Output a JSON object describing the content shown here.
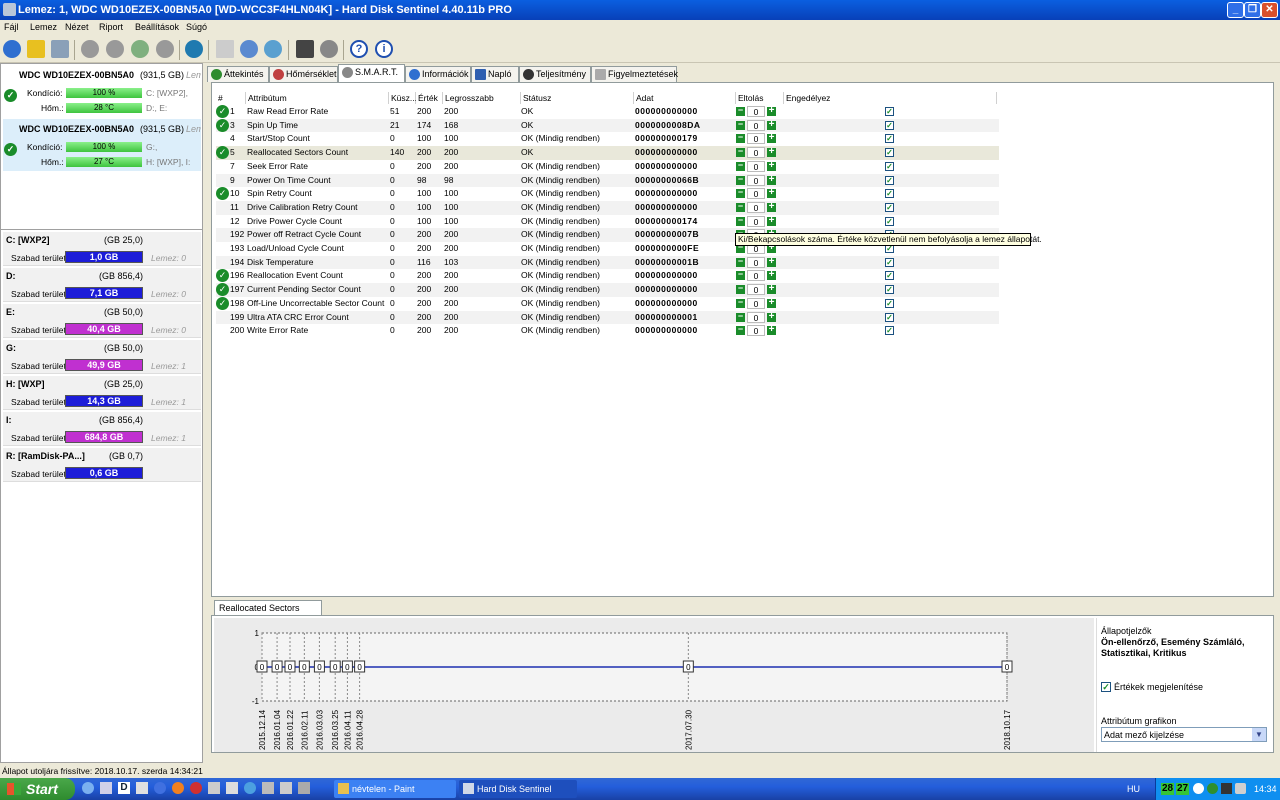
{
  "window": {
    "title": "Lemez: 1, WDC WD10EZEX-00BN5A0 [WD-WCC3F4HLN04K]  -  Hard Disk Sentinel 4.40.11b PRO"
  },
  "menu": [
    {
      "label": "Fájl"
    },
    {
      "label": "Lemez"
    },
    {
      "label": "Nézet"
    },
    {
      "label": "Riport"
    },
    {
      "label": "Beállítások"
    },
    {
      "label": "Súgó"
    }
  ],
  "disks": [
    {
      "name": "WDC WD10EZEX-00BN5A0",
      "size": "(931,5 GB)",
      "lem": "Lem",
      "cond_label": "Kondíció:",
      "cond_value": "100 %",
      "cond_parts": "C: [WXP2],",
      "temp_label": "Hőm.:",
      "temp_value": "28 °C",
      "temp_parts": "D:, E:"
    },
    {
      "name": "WDC WD10EZEX-00BN5A0",
      "size": "(931,5 GB)",
      "lem": "Lem",
      "cond_label": "Kondíció:",
      "cond_value": "100 %",
      "cond_parts": "G:,",
      "temp_label": "Hőm.:",
      "temp_value": "27 °C",
      "temp_parts": "H: [WXP], I:"
    }
  ],
  "partitions": [
    {
      "name": "C: [WXP2]",
      "size": "(25,0 GB)",
      "free_label": "Szabad terület",
      "free": "1,0 GB",
      "lemez": "Lemez: 0",
      "color": "#1c1cd8",
      "pct": 0.96
    },
    {
      "name": "D:",
      "size": "(856,4 GB)",
      "free_label": "Szabad terület",
      "free": "7,1 GB",
      "lemez": "Lemez: 0",
      "color": "#1c1cd8",
      "pct": 0.99
    },
    {
      "name": "E:",
      "size": "(50,0 GB)",
      "free_label": "Szabad terület",
      "free": "40,4 GB",
      "lemez": "Lemez: 0",
      "color": "#c030d0",
      "pct": 0.19
    },
    {
      "name": "G:",
      "size": "(50,0 GB)",
      "free_label": "Szabad terület",
      "free": "49,9 GB",
      "lemez": "Lemez: 1",
      "color": "#c030d0",
      "pct": 0.0
    },
    {
      "name": "H: [WXP]",
      "size": "(25,0 GB)",
      "free_label": "Szabad terület",
      "free": "14,3 GB",
      "lemez": "Lemez: 1",
      "color": "#1c1cd8",
      "pct": 0.43
    },
    {
      "name": "I:",
      "size": "(856,4 GB)",
      "free_label": "Szabad terület",
      "free": "684,8 GB",
      "lemez": "Lemez: 1",
      "color": "#c030d0",
      "pct": 0.2
    },
    {
      "name": "R: [RamDisk-PA...]",
      "size": "(0,7 GB)",
      "free_label": "Szabad terület",
      "free": "0,6 GB",
      "lemez": "",
      "color": "#1c1cd8",
      "pct": 0.14
    }
  ],
  "tabs": [
    {
      "label": "Áttekintés"
    },
    {
      "label": "Hőmérséklet"
    },
    {
      "label": "S.M.A.R.T."
    },
    {
      "label": "Információk"
    },
    {
      "label": "Napló"
    },
    {
      "label": "Teljesítmény"
    },
    {
      "label": "Figyelmeztetések"
    }
  ],
  "smart": {
    "headers": [
      "#",
      "Attribútum",
      "Küsz...",
      "Érték",
      "Legrosszabb",
      "Státusz",
      "Adat",
      "Eltolás",
      "Engedélyez"
    ],
    "rows": [
      {
        "id": "1",
        "name": "Raw Read Error Rate",
        "thr": "51",
        "val": "200",
        "worst": "200",
        "status": "OK",
        "data": "000000000000",
        "off": "0",
        "ok": true
      },
      {
        "id": "3",
        "name": "Spin Up Time",
        "thr": "21",
        "val": "174",
        "worst": "168",
        "status": "OK",
        "data": "0000000008DA",
        "off": "0",
        "ok": true
      },
      {
        "id": "4",
        "name": "Start/Stop Count",
        "thr": "0",
        "val": "100",
        "worst": "100",
        "status": "OK (Mindig rendben)",
        "data": "000000000179",
        "off": "0",
        "ok": false
      },
      {
        "id": "5",
        "name": "Reallocated Sectors Count",
        "thr": "140",
        "val": "200",
        "worst": "200",
        "status": "OK",
        "data": "000000000000",
        "off": "0",
        "ok": true
      },
      {
        "id": "7",
        "name": "Seek Error Rate",
        "thr": "0",
        "val": "200",
        "worst": "200",
        "status": "OK (Mindig rendben)",
        "data": "000000000000",
        "off": "0",
        "ok": false
      },
      {
        "id": "9",
        "name": "Power On Time Count",
        "thr": "0",
        "val": "98",
        "worst": "98",
        "status": "OK (Mindig rendben)",
        "data": "00000000066B",
        "off": "0",
        "ok": false
      },
      {
        "id": "10",
        "name": "Spin Retry Count",
        "thr": "0",
        "val": "100",
        "worst": "100",
        "status": "OK (Mindig rendben)",
        "data": "000000000000",
        "off": "0",
        "ok": true
      },
      {
        "id": "11",
        "name": "Drive Calibration Retry Count",
        "thr": "0",
        "val": "100",
        "worst": "100",
        "status": "OK (Mindig rendben)",
        "data": "000000000000",
        "off": "0",
        "ok": false
      },
      {
        "id": "12",
        "name": "Drive Power Cycle Count",
        "thr": "0",
        "val": "100",
        "worst": "100",
        "status": "OK (Mindig rendben)",
        "data": "000000000174",
        "off": "0",
        "ok": false
      },
      {
        "id": "192",
        "name": "Power off Retract Cycle Count",
        "thr": "0",
        "val": "200",
        "worst": "200",
        "status": "OK (Mindig rendben)",
        "data": "00000000007B",
        "off": "0",
        "ok": false
      },
      {
        "id": "193",
        "name": "Load/Unload Cycle Count",
        "thr": "0",
        "val": "200",
        "worst": "200",
        "status": "OK (Mindig rendben)",
        "data": "0000000000FE",
        "off": "0",
        "ok": false
      },
      {
        "id": "194",
        "name": "Disk Temperature",
        "thr": "0",
        "val": "116",
        "worst": "103",
        "status": "OK (Mindig rendben)",
        "data": "00000000001B",
        "off": "0",
        "ok": false
      },
      {
        "id": "196",
        "name": "Reallocation Event Count",
        "thr": "0",
        "val": "200",
        "worst": "200",
        "status": "OK (Mindig rendben)",
        "data": "000000000000",
        "off": "0",
        "ok": true
      },
      {
        "id": "197",
        "name": "Current Pending Sector Count",
        "thr": "0",
        "val": "200",
        "worst": "200",
        "status": "OK (Mindig rendben)",
        "data": "000000000000",
        "off": "0",
        "ok": true
      },
      {
        "id": "198",
        "name": "Off-Line Uncorrectable Sector Count",
        "thr": "0",
        "val": "200",
        "worst": "200",
        "status": "OK (Mindig rendben)",
        "data": "000000000000",
        "off": "0",
        "ok": true
      },
      {
        "id": "199",
        "name": "Ultra ATA CRC Error Count",
        "thr": "0",
        "val": "200",
        "worst": "200",
        "status": "OK (Mindig rendben)",
        "data": "000000000001",
        "off": "0",
        "ok": false
      },
      {
        "id": "200",
        "name": "Write Error Rate",
        "thr": "0",
        "val": "200",
        "worst": "200",
        "status": "OK (Mindig rendben)",
        "data": "000000000000",
        "off": "0",
        "ok": false
      }
    ]
  },
  "tooltip": "Ki/Bekapcsolások száma. Értéke közvetlenül nem befolyásolja a lemez állapotát.",
  "bottom": {
    "tab": "Reallocated Sectors Count",
    "status_title": "Állapotjelzők",
    "status_text": "Ön-ellenőrző, Esemény Számláló, Statisztikai, Kritikus",
    "show_values_label": "Értékek megjelenítése",
    "attr_graph_label": "Attribútum grafikon",
    "attr_graph_value": "Adat mező kijelzése"
  },
  "chart_data": {
    "type": "line",
    "x": [
      "2015.12.14",
      "2016.01.04",
      "2016.01.22",
      "2016.02.11",
      "2016.03.03",
      "2016.03.25",
      "2016.04.11",
      "2016.04.28",
      "2017.07.30",
      "2018.10.17"
    ],
    "values": [
      0,
      0,
      0,
      0,
      0,
      0,
      0,
      0,
      0,
      0
    ],
    "ylim": [
      -1,
      1
    ],
    "y_ticks": [
      "1",
      "0",
      "-1"
    ],
    "color": "#1c2fb0"
  },
  "statusbar": "Állapot utoljára frissítve: 2018.10.17. szerda 14:34:21",
  "taskbar": {
    "start": "Start",
    "tasks": [
      {
        "label": "névtelen - Paint"
      },
      {
        "label": "Hard Disk Sentinel"
      }
    ],
    "lang": "HU",
    "tray_temp1": "28",
    "tray_temp2": "27",
    "clock": "14:34"
  }
}
